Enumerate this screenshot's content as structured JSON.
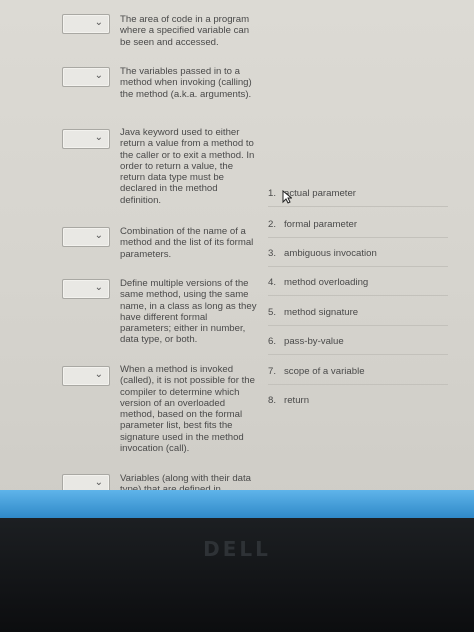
{
  "questions": [
    {
      "text": "The area of code in a program where a specified variable can be seen and accessed."
    },
    {
      "text": "The variables passed in to a method when invoking (calling) the method (a.k.a. arguments)."
    },
    {
      "text": "Java keyword used to either return a value from a method to the caller or to exit a method. In order to return a value, the return data type must be declared in the method definition."
    },
    {
      "text": "Combination of the name of a method and the list of its formal parameters."
    },
    {
      "text": "Define multiple versions of the same method, using the same name, in a class as long as they have different formal parameters; either in number, data type, or both."
    },
    {
      "text": "When a method is invoked (called), it is not possible for the compiler to determine which version of an overloaded method, based on the formal parameter list, best fits the signature used in the method invocation (call)."
    },
    {
      "text": "Variables (along with their data type) that are defined in"
    }
  ],
  "select_arrow": "⌄",
  "answers": [
    {
      "num": "1.",
      "label": "actual parameter"
    },
    {
      "num": "2.",
      "label": "formal parameter"
    },
    {
      "num": "3.",
      "label": "ambiguous invocation"
    },
    {
      "num": "4.",
      "label": "method overloading"
    },
    {
      "num": "5.",
      "label": "method signature"
    },
    {
      "num": "6.",
      "label": "pass-by-value"
    },
    {
      "num": "7.",
      "label": "scope of a variable"
    },
    {
      "num": "8.",
      "label": "return"
    }
  ],
  "bezel_logo": "DELL"
}
